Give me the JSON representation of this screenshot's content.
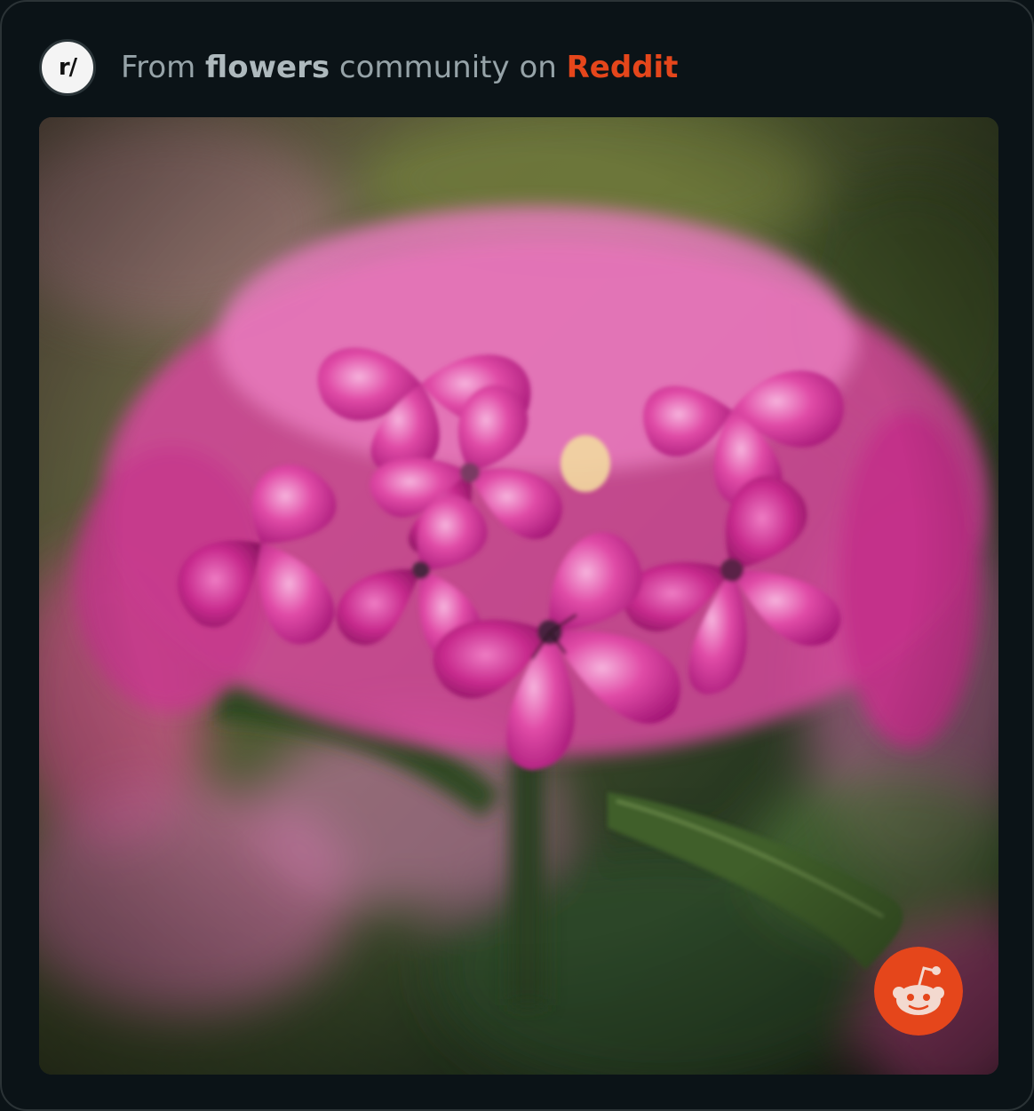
{
  "header": {
    "avatar_text": "r/",
    "prefix": "From ",
    "community": "flowers",
    "middle": " community on ",
    "platform": "Reddit"
  },
  "media": {
    "icon": "reddit-snoo-icon"
  },
  "colors": {
    "background": "#0b1317",
    "border": "#2b3336",
    "text_muted": "#96a3a8",
    "brand": "#e5461b"
  }
}
